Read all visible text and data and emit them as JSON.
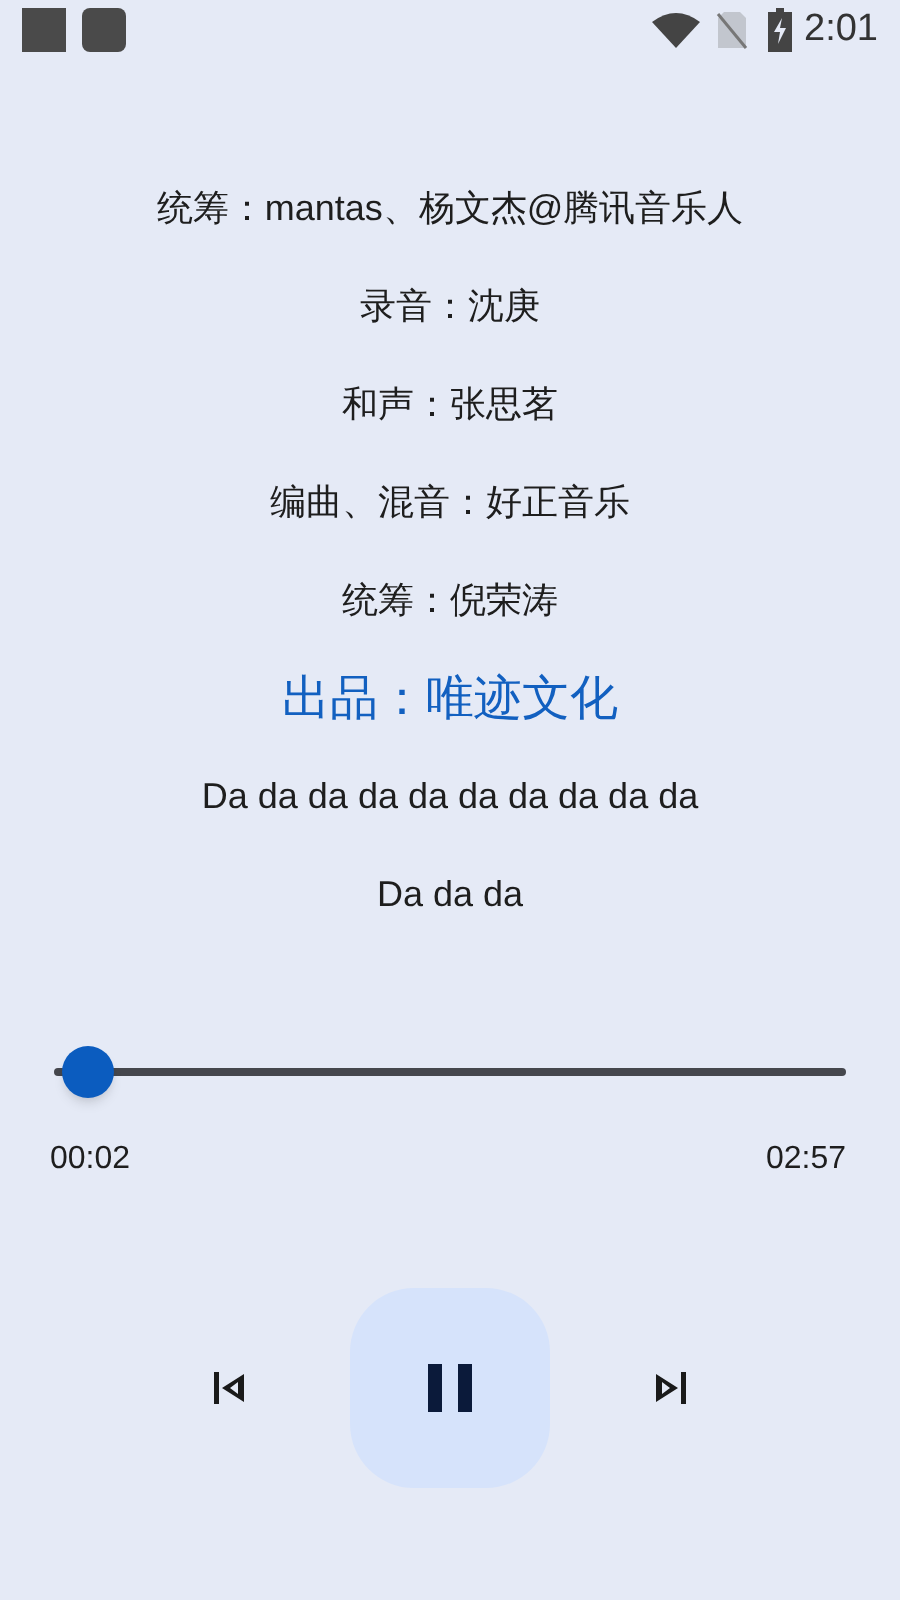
{
  "status_bar": {
    "time": "2:01"
  },
  "lyrics": [
    {
      "text": "统筹：mantas、杨文杰@腾讯音乐人",
      "selected": false
    },
    {
      "text": "录音：沈庚",
      "selected": false
    },
    {
      "text": "和声：张思茗",
      "selected": false
    },
    {
      "text": "编曲、混音：好正音乐",
      "selected": false
    },
    {
      "text": "统筹：倪荣涛",
      "selected": false
    },
    {
      "text": "出品：唯迹文化",
      "selected": true
    },
    {
      "text": "Da da da da da da da da da da",
      "selected": false
    },
    {
      "text": "Da da da",
      "selected": false
    }
  ],
  "progress": {
    "level": 0.01,
    "elapsed": "00:02",
    "total": "02:57"
  },
  "player": {
    "playing": true
  }
}
